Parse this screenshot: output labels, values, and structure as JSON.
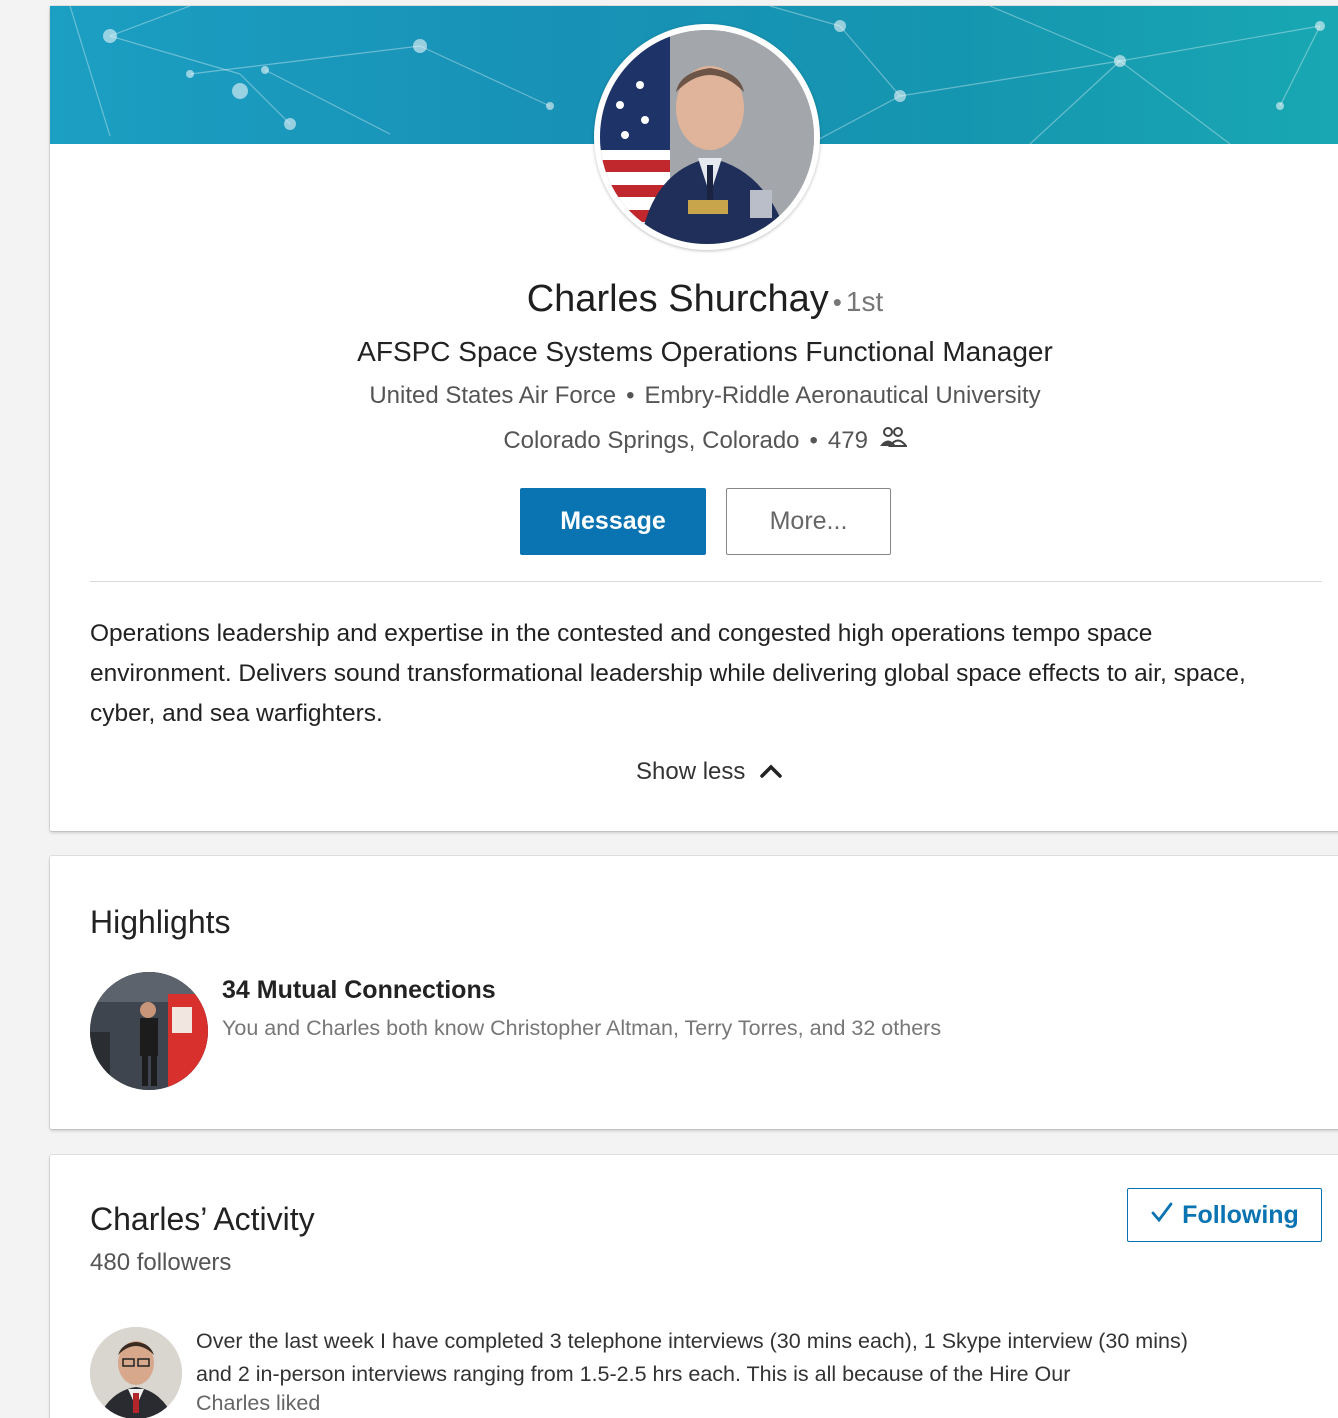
{
  "profile": {
    "name": "Charles Shurchay",
    "degree": "1st",
    "headline": "AFSPC Space Systems Operations Functional Manager",
    "company": "United States Air Force",
    "school": "Embry-Riddle Aeronautical University",
    "location": "Colorado Springs, Colorado",
    "connections": "479",
    "connections_icon": "people-icon",
    "message_label": "Message",
    "more_label": "More...",
    "summary": "Operations leadership and expertise in the contested and congested high operations tempo space environment. Delivers sound transformational leadership while delivering global space effects to air, space, cyber, and sea warfighters.",
    "show_less_label": "Show less",
    "show_less_icon": "chevron-up-icon"
  },
  "highlights": {
    "title": "Highlights",
    "mutual_title": "34 Mutual Connections",
    "mutual_sub": "You and Charles both know Christopher Altman, Terry Torres, and 32 others"
  },
  "activity": {
    "title": "Charles’ Activity",
    "followers": "480 followers",
    "following_label": "Following",
    "following_icon": "checkmark-icon",
    "post_text": "Over the last week I have completed 3 telephone interviews (30 mins each), 1 Skype interview (30 mins) and 2 in-person interviews ranging from 1.5-2.5 hrs each.  This is all because of the Hire Our",
    "post_meta": "Charles liked"
  },
  "colors": {
    "accent": "#0a73b1",
    "banner": "#1891b6"
  }
}
